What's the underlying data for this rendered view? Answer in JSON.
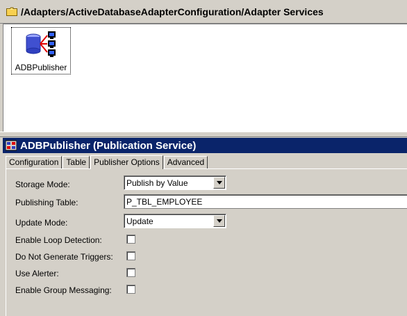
{
  "path_title": "/Adapters/ActiveDatabaseAdapterConfiguration/Adapter Services",
  "services": [
    {
      "label": "ADBPublisher",
      "icon": "database-publisher-icon"
    }
  ],
  "detail": {
    "title": "ADBPublisher (Publication Service)",
    "header_color": "#0a246a",
    "tabs": [
      "Configuration",
      "Table",
      "Publisher Options",
      "Advanced"
    ],
    "active_tab": "Publisher Options"
  },
  "form": {
    "storage_mode": {
      "label": "Storage Mode:",
      "value": "Publish by Value"
    },
    "publishing_table": {
      "label": "Publishing Table:",
      "value": "P_TBL_EMPLOYEE"
    },
    "update_mode": {
      "label": "Update Mode:",
      "value": "Update"
    },
    "loop_detection": {
      "label": "Enable Loop Detection:",
      "checked": false
    },
    "no_triggers": {
      "label": "Do Not Generate Triggers:",
      "checked": false
    },
    "use_alerter": {
      "label": "Use Alerter:",
      "checked": false
    },
    "group_messaging": {
      "label": "Enable Group Messaging:",
      "checked": false
    }
  }
}
